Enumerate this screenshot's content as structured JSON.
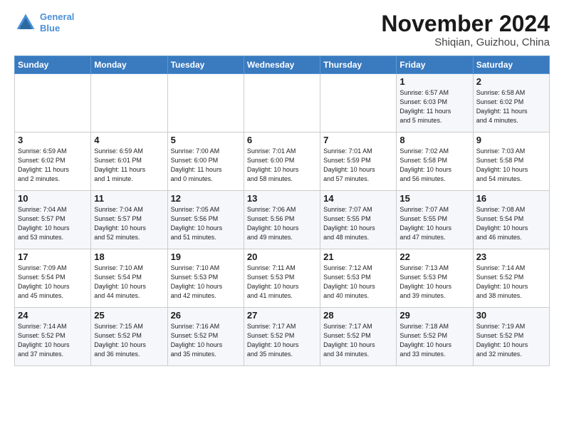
{
  "header": {
    "logo_line1": "General",
    "logo_line2": "Blue",
    "month_title": "November 2024",
    "location": "Shiqian, Guizhou, China"
  },
  "weekdays": [
    "Sunday",
    "Monday",
    "Tuesday",
    "Wednesday",
    "Thursday",
    "Friday",
    "Saturday"
  ],
  "weeks": [
    [
      {
        "day": "",
        "info": ""
      },
      {
        "day": "",
        "info": ""
      },
      {
        "day": "",
        "info": ""
      },
      {
        "day": "",
        "info": ""
      },
      {
        "day": "",
        "info": ""
      },
      {
        "day": "1",
        "info": "Sunrise: 6:57 AM\nSunset: 6:03 PM\nDaylight: 11 hours\nand 5 minutes."
      },
      {
        "day": "2",
        "info": "Sunrise: 6:58 AM\nSunset: 6:02 PM\nDaylight: 11 hours\nand 4 minutes."
      }
    ],
    [
      {
        "day": "3",
        "info": "Sunrise: 6:59 AM\nSunset: 6:02 PM\nDaylight: 11 hours\nand 2 minutes."
      },
      {
        "day": "4",
        "info": "Sunrise: 6:59 AM\nSunset: 6:01 PM\nDaylight: 11 hours\nand 1 minute."
      },
      {
        "day": "5",
        "info": "Sunrise: 7:00 AM\nSunset: 6:00 PM\nDaylight: 11 hours\nand 0 minutes."
      },
      {
        "day": "6",
        "info": "Sunrise: 7:01 AM\nSunset: 6:00 PM\nDaylight: 10 hours\nand 58 minutes."
      },
      {
        "day": "7",
        "info": "Sunrise: 7:01 AM\nSunset: 5:59 PM\nDaylight: 10 hours\nand 57 minutes."
      },
      {
        "day": "8",
        "info": "Sunrise: 7:02 AM\nSunset: 5:58 PM\nDaylight: 10 hours\nand 56 minutes."
      },
      {
        "day": "9",
        "info": "Sunrise: 7:03 AM\nSunset: 5:58 PM\nDaylight: 10 hours\nand 54 minutes."
      }
    ],
    [
      {
        "day": "10",
        "info": "Sunrise: 7:04 AM\nSunset: 5:57 PM\nDaylight: 10 hours\nand 53 minutes."
      },
      {
        "day": "11",
        "info": "Sunrise: 7:04 AM\nSunset: 5:57 PM\nDaylight: 10 hours\nand 52 minutes."
      },
      {
        "day": "12",
        "info": "Sunrise: 7:05 AM\nSunset: 5:56 PM\nDaylight: 10 hours\nand 51 minutes."
      },
      {
        "day": "13",
        "info": "Sunrise: 7:06 AM\nSunset: 5:56 PM\nDaylight: 10 hours\nand 49 minutes."
      },
      {
        "day": "14",
        "info": "Sunrise: 7:07 AM\nSunset: 5:55 PM\nDaylight: 10 hours\nand 48 minutes."
      },
      {
        "day": "15",
        "info": "Sunrise: 7:07 AM\nSunset: 5:55 PM\nDaylight: 10 hours\nand 47 minutes."
      },
      {
        "day": "16",
        "info": "Sunrise: 7:08 AM\nSunset: 5:54 PM\nDaylight: 10 hours\nand 46 minutes."
      }
    ],
    [
      {
        "day": "17",
        "info": "Sunrise: 7:09 AM\nSunset: 5:54 PM\nDaylight: 10 hours\nand 45 minutes."
      },
      {
        "day": "18",
        "info": "Sunrise: 7:10 AM\nSunset: 5:54 PM\nDaylight: 10 hours\nand 44 minutes."
      },
      {
        "day": "19",
        "info": "Sunrise: 7:10 AM\nSunset: 5:53 PM\nDaylight: 10 hours\nand 42 minutes."
      },
      {
        "day": "20",
        "info": "Sunrise: 7:11 AM\nSunset: 5:53 PM\nDaylight: 10 hours\nand 41 minutes."
      },
      {
        "day": "21",
        "info": "Sunrise: 7:12 AM\nSunset: 5:53 PM\nDaylight: 10 hours\nand 40 minutes."
      },
      {
        "day": "22",
        "info": "Sunrise: 7:13 AM\nSunset: 5:53 PM\nDaylight: 10 hours\nand 39 minutes."
      },
      {
        "day": "23",
        "info": "Sunrise: 7:14 AM\nSunset: 5:52 PM\nDaylight: 10 hours\nand 38 minutes."
      }
    ],
    [
      {
        "day": "24",
        "info": "Sunrise: 7:14 AM\nSunset: 5:52 PM\nDaylight: 10 hours\nand 37 minutes."
      },
      {
        "day": "25",
        "info": "Sunrise: 7:15 AM\nSunset: 5:52 PM\nDaylight: 10 hours\nand 36 minutes."
      },
      {
        "day": "26",
        "info": "Sunrise: 7:16 AM\nSunset: 5:52 PM\nDaylight: 10 hours\nand 35 minutes."
      },
      {
        "day": "27",
        "info": "Sunrise: 7:17 AM\nSunset: 5:52 PM\nDaylight: 10 hours\nand 35 minutes."
      },
      {
        "day": "28",
        "info": "Sunrise: 7:17 AM\nSunset: 5:52 PM\nDaylight: 10 hours\nand 34 minutes."
      },
      {
        "day": "29",
        "info": "Sunrise: 7:18 AM\nSunset: 5:52 PM\nDaylight: 10 hours\nand 33 minutes."
      },
      {
        "day": "30",
        "info": "Sunrise: 7:19 AM\nSunset: 5:52 PM\nDaylight: 10 hours\nand 32 minutes."
      }
    ]
  ]
}
